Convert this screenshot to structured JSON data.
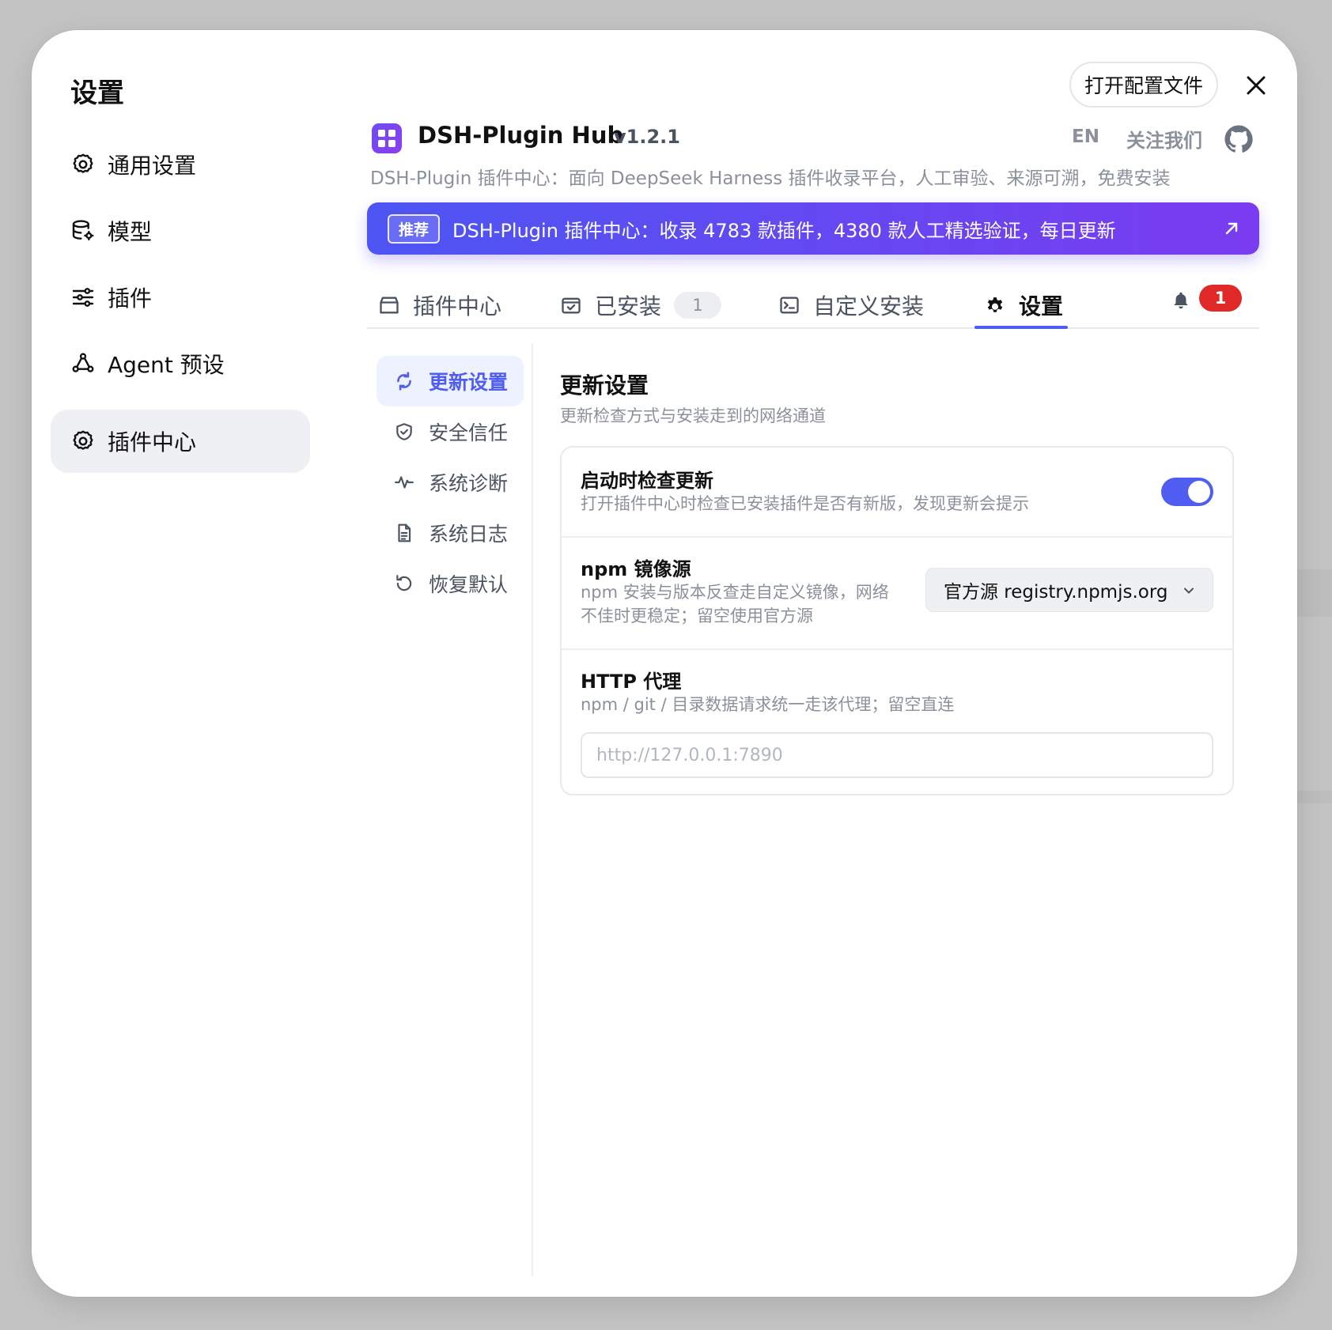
{
  "dialog": {
    "title": "设置",
    "open_config_label": "打开配置文件"
  },
  "sidebar": {
    "items": [
      {
        "label": "通用设置",
        "icon": "gear-icon"
      },
      {
        "label": "模型",
        "icon": "database-gear-icon"
      },
      {
        "label": "插件",
        "icon": "sliders-icon"
      },
      {
        "label": "Agent 预设",
        "icon": "agent-icon"
      },
      {
        "label": "插件中心",
        "icon": "gear-icon",
        "active": true
      }
    ]
  },
  "app": {
    "name": "DSH-Plugin Hub",
    "version": "v1.2.1",
    "lang": "EN",
    "follow": "关注我们",
    "description": "DSH-Plugin 插件中心：面向 DeepSeek Harness 插件收录平台，人工审验、来源可溯，免费安装"
  },
  "banner": {
    "tag": "推荐",
    "text": "DSH-Plugin 插件中心：收录 4783 款插件，4380 款人工精选验证，每日更新"
  },
  "tabs": [
    {
      "label": "插件中心",
      "icon": "store-icon"
    },
    {
      "label": "已安装",
      "icon": "check-box-icon",
      "count": "1"
    },
    {
      "label": "自定义安装",
      "icon": "terminal-icon"
    },
    {
      "label": "设置",
      "icon": "gear-icon",
      "active": true
    }
  ],
  "notifications": {
    "count": "1"
  },
  "subnav": {
    "items": [
      {
        "label": "更新设置",
        "icon": "refresh-icon",
        "active": true
      },
      {
        "label": "安全信任",
        "icon": "shield-icon"
      },
      {
        "label": "系统诊断",
        "icon": "pulse-icon"
      },
      {
        "label": "系统日志",
        "icon": "file-icon"
      },
      {
        "label": "恢复默认",
        "icon": "reset-icon"
      }
    ]
  },
  "update_settings": {
    "title": "更新设置",
    "subtitle": "更新检查方式与安装走到的网络通道",
    "check_on_start": {
      "label": "启动时检查更新",
      "desc": "打开插件中心时检查已安装插件是否有新版，发现更新会提示",
      "enabled": true
    },
    "npm_mirror": {
      "label": "npm 镜像源",
      "desc_line1": "npm 安装与版本反查走自定义镜像，网络",
      "desc_line2": "不佳时更稳定；留空使用官方源",
      "selected": "官方源 registry.npmjs.org"
    },
    "http_proxy": {
      "label": "HTTP 代理",
      "desc": "npm / git / 目录数据请求统一走该代理；留空直连",
      "value": "",
      "placeholder": "http://127.0.0.1:7890"
    }
  },
  "colors": {
    "accent": "#4f5ef0",
    "banner_start": "#4d55f2",
    "banner_end": "#7a3cf0",
    "badge_red": "#e02a2a"
  }
}
